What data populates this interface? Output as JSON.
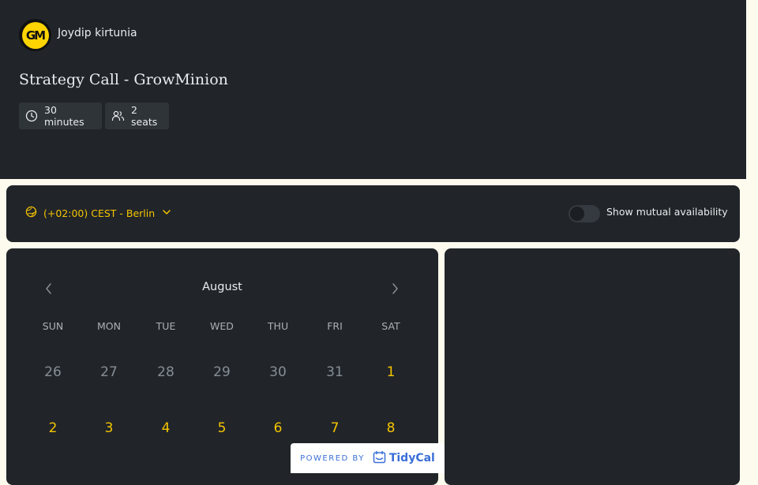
{
  "header": {
    "host_name": "Joydip kirtunia",
    "avatar_text": "GM",
    "event_title": "Strategy Call - GrowMinion",
    "duration": "30 minutes",
    "seats": "2 seats"
  },
  "timezone_bar": {
    "timezone_label": "(+02:00) CEST - Berlin",
    "mutual_toggle_label": "Show mutual availability",
    "mutual_toggle_on": false
  },
  "calendar": {
    "month": "August",
    "weekdays": [
      "SUN",
      "MON",
      "TUE",
      "WED",
      "THU",
      "FRI",
      "SAT"
    ],
    "row1": [
      "26",
      "27",
      "28",
      "29",
      "30",
      "31",
      "1"
    ],
    "row2": [
      "2",
      "3",
      "4",
      "5",
      "6",
      "7",
      "8"
    ]
  },
  "footer": {
    "powered_by": "POWERED BY",
    "brand": "TidyCal"
  },
  "colors": {
    "background": "#212529",
    "accent": "#f5c400",
    "page": "#fdfbee"
  }
}
